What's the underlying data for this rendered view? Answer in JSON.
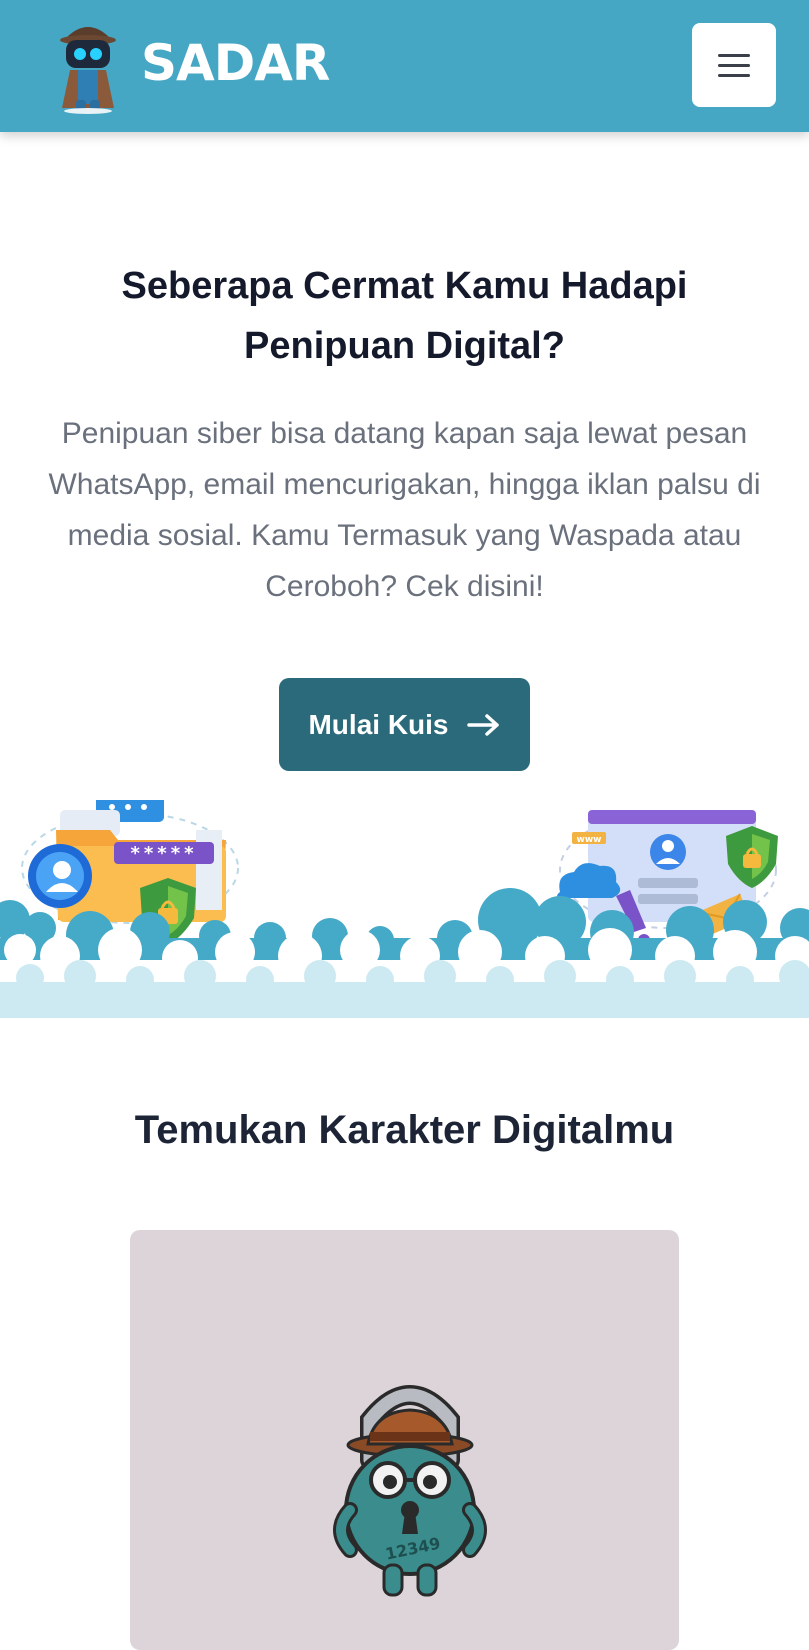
{
  "header": {
    "brand": "SADAR",
    "logo_icon": "detective-robot-logo-icon",
    "menu_icon": "hamburger-menu-icon",
    "background_color": "#46a7c5"
  },
  "hero": {
    "title": "Seberapa Cermat Kamu Hadapi Penipuan Digital?",
    "description": "Penipuan siber bisa datang kapan saja lewat pesan WhatsApp, email mencurigakan, hingga iklan palsu di media sosial. Kamu Termasuk yang Waspada atau Ceroboh? Cek disini!",
    "cta_label": "Mulai Kuis",
    "cta_icon": "arrow-right-icon",
    "cta_color": "#2b6a7b",
    "illustration_left_password": "*****",
    "illustration_right_www": "www"
  },
  "characters": {
    "title": "Temukan Karakter Digitalmu",
    "card_background": "#ddd4d9",
    "card_mascot_icon": "padlock-detective-mascot-icon",
    "mascot_combination": "12349"
  }
}
